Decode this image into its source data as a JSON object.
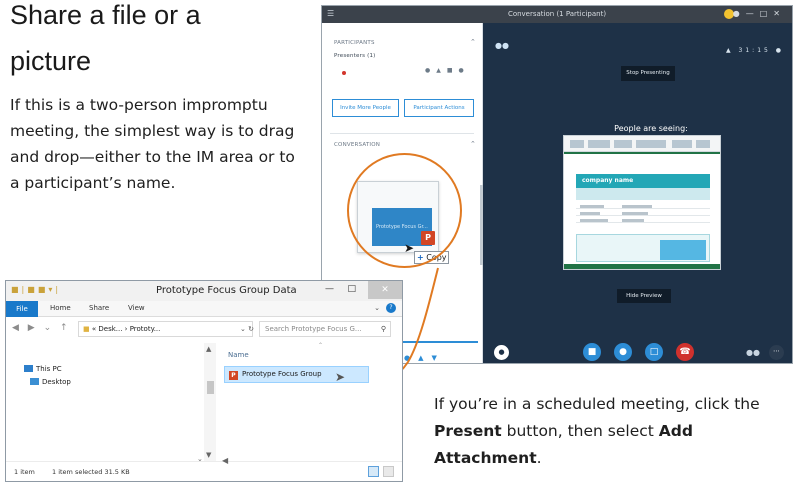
{
  "article": {
    "heading_line1": "Share a file or a",
    "heading_line2": "picture",
    "intro": "If this is a two-person impromptu meeting, the simplest way is to drag and drop—either to the IM area or to a participant’s name.",
    "note_prefix": "If you’re in a scheduled meeting, click the ",
    "note_bold1": "Present",
    "note_middle": " button, then select ",
    "note_bold2": "Add Attachment",
    "note_suffix": "."
  },
  "skype": {
    "title": "Conversation (1 Participant)",
    "participants_label": "PARTICIPANTS",
    "presenters_label": "Presenters (1)",
    "invite_button": "Invite More People",
    "actions_button": "Participant Actions",
    "conversation_label": "CONVERSATION",
    "time_readout": "31:15",
    "stop_presenting": "Stop Presenting",
    "people_seeing": "People are seeing:",
    "preview_company": "company name",
    "hide_preview": "Hide Preview",
    "dragged_slide_text": "Prototype Focus Gr...",
    "copy_label": "Copy",
    "accent_color": "#2d8dd6",
    "stage_color": "#1e3147",
    "icons": {
      "video": "video-camera-icon",
      "mic": "microphone-icon",
      "present": "present-screen-icon",
      "hangup": "phone-hangup-icon"
    }
  },
  "explorer": {
    "title": "Prototype Focus Group Data",
    "tab_file": "File",
    "tab_home": "Home",
    "tab_share": "Share",
    "tab_view": "View",
    "address": "« Desk... › Prototy...",
    "search_placeholder": "Search Prototype Focus G...",
    "tree_this_pc": "This PC",
    "tree_desktop": "Desktop",
    "column_name": "Name",
    "file_name": "Prototype Focus Group",
    "status_items": "1 item",
    "status_selected": "1 item selected  31.5 KB"
  },
  "highlight_color": "#e07a22"
}
